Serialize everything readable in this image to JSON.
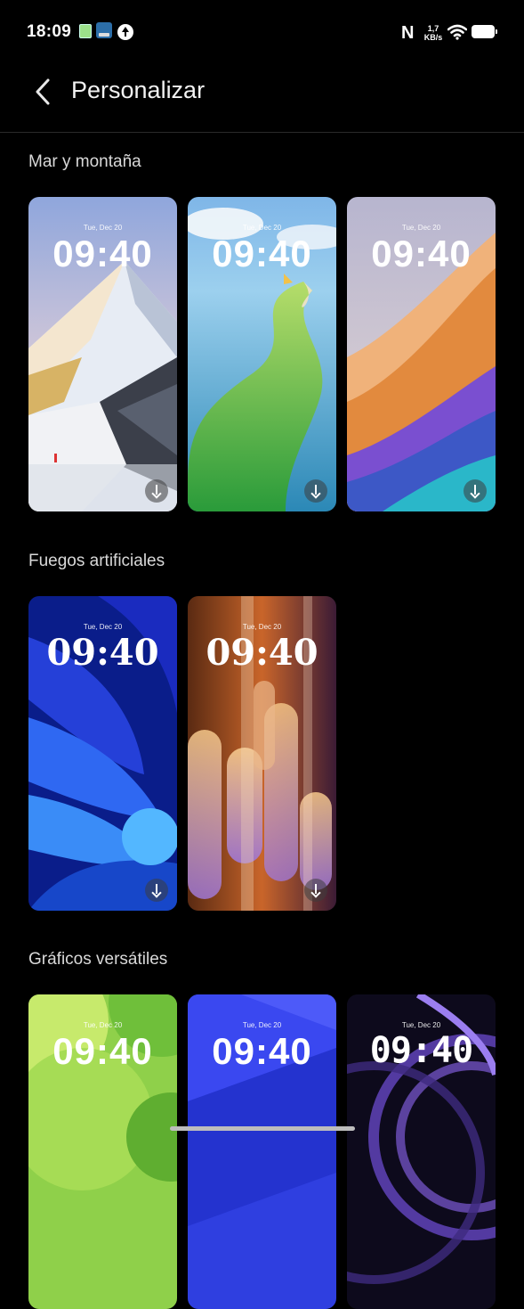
{
  "status_bar": {
    "time": "18:09",
    "net_speed_value": "1,7",
    "net_speed_unit": "KB/s",
    "icons": [
      "photo-notification-icon",
      "app-notification-icon",
      "upload-notification-icon",
      "nfc-icon",
      "wifi-icon",
      "battery-icon"
    ]
  },
  "header": {
    "title": "Personalizar"
  },
  "sections": [
    {
      "title": "Mar y montaña",
      "cards": [
        {
          "date": "Tue, Dec 20",
          "clock": "09:40",
          "theme": "mountain"
        },
        {
          "date": "Tue, Dec 20",
          "clock": "09:40",
          "theme": "island"
        },
        {
          "date": "Tue, Dec 20",
          "clock": "09:40",
          "theme": "waves"
        }
      ]
    },
    {
      "title": "Fuegos artificiales",
      "cards": [
        {
          "date": "Tue, Dec 20",
          "clock": "09:40",
          "theme": "blue-petals"
        },
        {
          "date": "Tue, Dec 20",
          "clock": "09:40",
          "theme": "light-bars"
        }
      ]
    },
    {
      "title": "Gráficos versátiles",
      "cards": [
        {
          "date": "Tue, Dec 20",
          "clock": "09:40",
          "theme": "green-circles"
        },
        {
          "date": "Tue, Dec 20",
          "clock": "09:40",
          "theme": "blue-facets"
        },
        {
          "date": "Tue, Dec 20",
          "clock": "09:40",
          "theme": "purple-arcs"
        }
      ]
    }
  ],
  "colors": {
    "background": "#000000",
    "text": "#ffffff",
    "section_title": "#d9d9d9"
  }
}
